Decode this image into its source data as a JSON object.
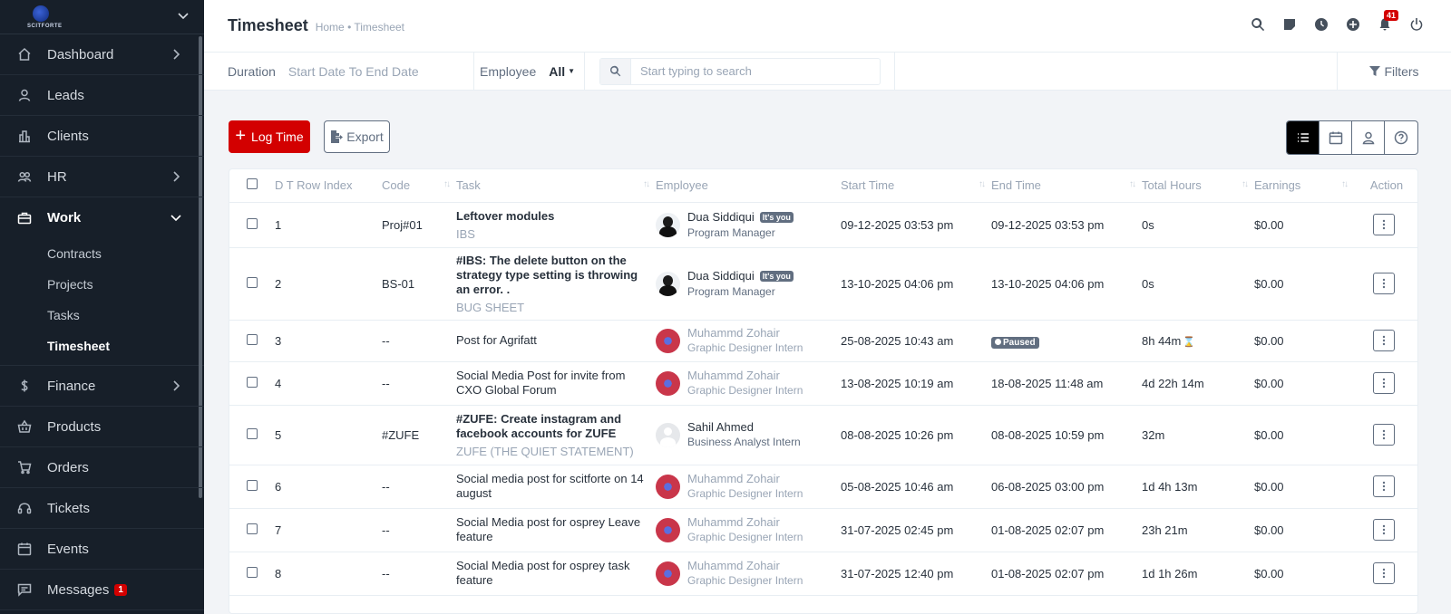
{
  "sidebar": {
    "logo_text": "SCITFORTE",
    "items": [
      {
        "label": "Dashboard",
        "icon": "home-icon",
        "has_chevron": true
      },
      {
        "label": "Leads",
        "icon": "user-icon"
      },
      {
        "label": "Clients",
        "icon": "building-icon"
      },
      {
        "label": "HR",
        "icon": "people-icon",
        "has_chevron": true
      },
      {
        "label": "Work",
        "icon": "briefcase-icon",
        "expanded": true
      },
      {
        "label": "Finance",
        "icon": "dollar-icon",
        "has_chevron": true
      },
      {
        "label": "Products",
        "icon": "basket-icon"
      },
      {
        "label": "Orders",
        "icon": "cart-icon"
      },
      {
        "label": "Tickets",
        "icon": "headset-icon"
      },
      {
        "label": "Events",
        "icon": "calendar-icon"
      },
      {
        "label": "Messages",
        "icon": "chat-icon",
        "badge": "1"
      }
    ],
    "work_sub": [
      "Contracts",
      "Projects",
      "Tasks",
      "Timesheet"
    ]
  },
  "header": {
    "title": "Timesheet",
    "breadcrumb": "Home • Timesheet",
    "notification_count": "41"
  },
  "filters": {
    "duration_label": "Duration",
    "duration_value": "Start Date To End Date",
    "employee_label": "Employee",
    "employee_value": "All",
    "search_placeholder": "Start typing to search",
    "filters_label": "Filters"
  },
  "actions": {
    "log_time": "Log Time",
    "export": "Export"
  },
  "table": {
    "columns": [
      "D T Row Index",
      "Code",
      "Task",
      "Employee",
      "Start Time",
      "End Time",
      "Total Hours",
      "Earnings",
      "Action"
    ],
    "you_badge": "It's you",
    "paused_label": "Paused",
    "rows": [
      {
        "idx": "1",
        "code": "Proj#01",
        "task": "Leftover modules",
        "project": "IBS",
        "bold": true,
        "emp": "Dua Siddiqui",
        "role": "Program Manager",
        "you": true,
        "start": "09-12-2025 03:53 pm",
        "end": "09-12-2025 03:53 pm",
        "hours": "0s",
        "earn": "$0.00"
      },
      {
        "idx": "2",
        "code": "BS-01",
        "task": "#IBS: The delete button on the strategy type setting is throwing an error. .",
        "project": "BUG SHEET",
        "bold": true,
        "emp": "Dua Siddiqui",
        "role": "Program Manager",
        "you": true,
        "start": "13-10-2025 04:06 pm",
        "end": "13-10-2025 04:06 pm",
        "hours": "0s",
        "earn": "$0.00"
      },
      {
        "idx": "3",
        "code": "--",
        "task": "Post for Agrifatt",
        "project": "",
        "emp": "Muhammd Zohair",
        "role": "Graphic Designer Intern",
        "start": "25-08-2025 10:43 am",
        "end": "",
        "paused": true,
        "hours": "8h 44m",
        "hourglass": true,
        "earn": "$0.00"
      },
      {
        "idx": "4",
        "code": "--",
        "task": "Social Media Post for invite from CXO Global Forum",
        "project": "",
        "emp": "Muhammd Zohair",
        "role": "Graphic Designer Intern",
        "start": "13-08-2025 10:19 am",
        "end": "18-08-2025 11:48 am",
        "hours": "4d 22h 14m",
        "earn": "$0.00"
      },
      {
        "idx": "5",
        "code": "#ZUFE",
        "task": "#ZUFE: Create instagram and facebook accounts for ZUFE",
        "project": "ZUFE (THE QUIET STATEMENT)",
        "bold": true,
        "emp": "Sahil Ahmed",
        "role": "Business Analyst Intern",
        "start": "08-08-2025 10:26 pm",
        "end": "08-08-2025 10:59 pm",
        "hours": "32m",
        "earn": "$0.00"
      },
      {
        "idx": "6",
        "code": "--",
        "task": "Social media post for scitforte on 14 august",
        "project": "",
        "emp": "Muhammd Zohair",
        "role": "Graphic Designer Intern",
        "start": "05-08-2025 10:46 am",
        "end": "06-08-2025 03:00 pm",
        "hours": "1d 4h 13m",
        "earn": "$0.00"
      },
      {
        "idx": "7",
        "code": "--",
        "task": "Social Media post for osprey Leave feature",
        "project": "",
        "emp": "Muhammd Zohair",
        "role": "Graphic Designer Intern",
        "start": "31-07-2025 02:45 pm",
        "end": "01-08-2025 02:07 pm",
        "hours": "23h 21m",
        "earn": "$0.00"
      },
      {
        "idx": "8",
        "code": "--",
        "task": "Social Media post for osprey task feature",
        "project": "",
        "emp": "Muhammd Zohair",
        "role": "Graphic Designer Intern",
        "start": "31-07-2025 12:40 pm",
        "end": "01-08-2025 02:07 pm",
        "hours": "1d 1h 26m",
        "earn": "$0.00"
      }
    ]
  }
}
